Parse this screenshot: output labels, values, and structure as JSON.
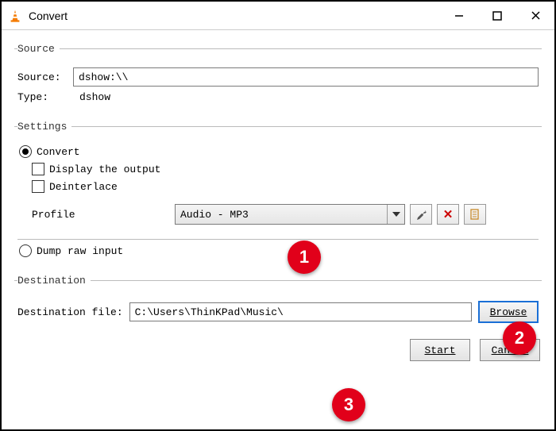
{
  "window": {
    "title": "Convert"
  },
  "source": {
    "legend": "Source",
    "label": "Source:",
    "value": "dshow:\\\\",
    "type_label": "Type:",
    "type_value": "dshow"
  },
  "settings": {
    "legend": "Settings",
    "convert_label": "Convert",
    "display_output_label": "Display the output",
    "deinterlace_label": "Deinterlace",
    "profile_label": "Profile",
    "profile_selected": "Audio - MP3",
    "dump_label": "Dump raw input"
  },
  "destination": {
    "legend": "Destination",
    "label": "Destination file:",
    "value": "C:\\Users\\ThinKPad\\Music\\",
    "browse": "Browse"
  },
  "footer": {
    "start": "Start",
    "cancel": "Cancel"
  },
  "callouts": {
    "one": "1",
    "two": "2",
    "three": "3"
  }
}
